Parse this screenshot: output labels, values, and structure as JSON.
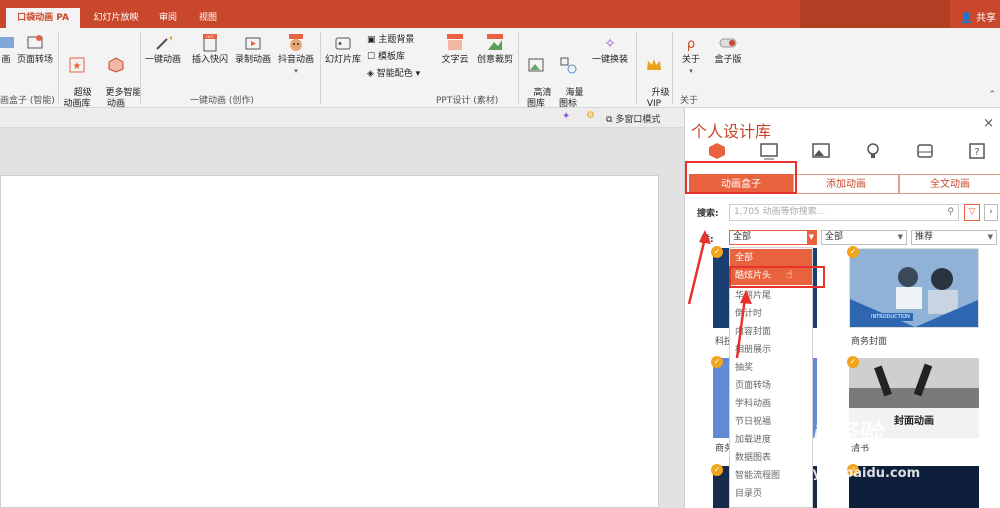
{
  "tabs": [
    "口袋动画 PA",
    "幻灯片放映",
    "审阅",
    "视图"
  ],
  "share": "共享",
  "ribbon": {
    "buttons": [
      {
        "label": "画"
      },
      {
        "label": "页面转场"
      },
      {
        "label": "超级\n动画库"
      },
      {
        "label": "更多智能\n动画"
      },
      {
        "label": "一键动画"
      },
      {
        "label": "插入快闪"
      },
      {
        "label": "录制动画"
      },
      {
        "label": "抖音动画"
      },
      {
        "label": "幻灯片库"
      },
      {
        "label": "文字云"
      },
      {
        "label": "创意裁剪"
      },
      {
        "label": "高清\n图库"
      },
      {
        "label": "海量\n图标"
      },
      {
        "label": "一键换装"
      },
      {
        "label": "升级\nVIP"
      },
      {
        "label": "关于"
      },
      {
        "label": "盒子版"
      }
    ],
    "small": [
      "主题背景",
      "模板库",
      "智能配色"
    ],
    "hot": "HOT",
    "groups": [
      "画盒子 (智能)",
      "一键动画 (创作)",
      "PPT设计 (素材)",
      "关于"
    ]
  },
  "subbar": {
    "multiwindow": "多窗口模式"
  },
  "panel": {
    "title": "个人设计库",
    "close": "×",
    "tabs": [
      "动画盒子",
      "添加动画",
      "全文动画"
    ],
    "search_label": "搜索:",
    "search_placeholder": "1,705 动画等你搜索...",
    "filter_label": "类:",
    "selects": [
      "全部",
      "全部",
      "推荐"
    ],
    "dropdown": [
      "全部",
      "酷炫片头",
      "华丽片尾",
      "倒计时",
      "内容封面",
      "相册展示",
      "抽奖",
      "页面转场",
      "学科动画",
      "节日祝福",
      "加载进度",
      "数据图表",
      "智能流程图",
      "目录页"
    ],
    "thumbs": [
      {
        "caption": "科技",
        "badge": "✓"
      },
      {
        "caption": "商务封面",
        "badge": "✓",
        "text": "INTRODUCTION"
      },
      {
        "caption": "商务",
        "badge": "✓"
      },
      {
        "caption": "清书",
        "badge": "✓",
        "text": "封面动画"
      },
      {
        "caption": "",
        "badge": "✓"
      },
      {
        "caption": "",
        "badge": "✓"
      }
    ],
    "watermark": "Bai 经验",
    "watermark_url": "jingyan.baidu.com"
  },
  "colors": {
    "accent": "#c9472b",
    "tab_active": "#e9623e",
    "highlight": "#e8312b"
  }
}
